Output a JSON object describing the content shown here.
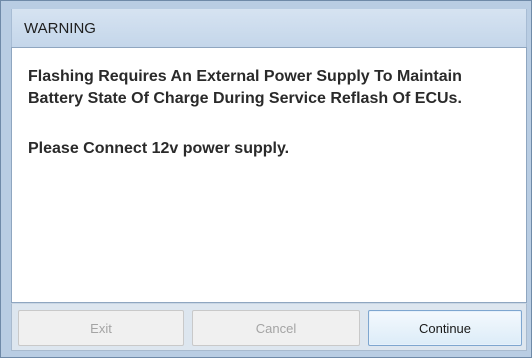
{
  "window": {
    "title": "WARNING"
  },
  "message": {
    "line1": "Flashing Requires An External Power Supply To Maintain Battery State Of Charge During Service Reflash Of ECUs.",
    "line2": "Please Connect 12v power supply."
  },
  "buttons": {
    "exit": {
      "label": "Exit",
      "state": "disabled"
    },
    "cancel": {
      "label": "Cancel",
      "state": "disabled"
    },
    "continue": {
      "label": "Continue",
      "state": "enabled"
    }
  },
  "colors": {
    "frame": "#b9cde3",
    "content_bg": "#ffffff",
    "text": "#2a2a2a",
    "disabled_text": "#a4a4a4",
    "primary_border": "#7ea6cf"
  }
}
